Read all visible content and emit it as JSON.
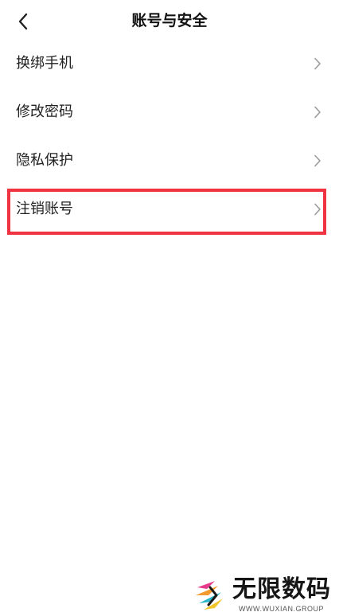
{
  "header": {
    "title": "账号与安全",
    "back_icon": "chevron-left-icon"
  },
  "menu": [
    {
      "label": "换绑手机",
      "icon": "chevron-right-icon"
    },
    {
      "label": "修改密码",
      "icon": "chevron-right-icon"
    },
    {
      "label": "隐私保护",
      "icon": "chevron-right-icon"
    },
    {
      "label": "注销账号",
      "icon": "chevron-right-icon",
      "highlighted": true
    }
  ],
  "highlight_color": "#ef3340",
  "watermark": {
    "brand": "无限数码",
    "url": "WWW.WUXIAN.GROUP"
  }
}
